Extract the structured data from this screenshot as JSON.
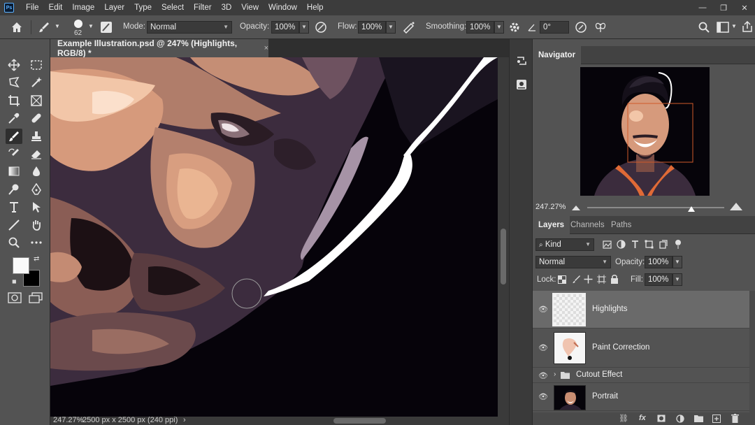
{
  "app": {
    "logo": "Ps"
  },
  "menu": [
    "File",
    "Edit",
    "Image",
    "Layer",
    "Type",
    "Select",
    "Filter",
    "3D",
    "View",
    "Window",
    "Help"
  ],
  "window_controls": [
    "—",
    "❐",
    "✕"
  ],
  "options": {
    "brush_size": "62",
    "mode_label": "Mode:",
    "mode_value": "Normal",
    "opacity_label": "Opacity:",
    "opacity_value": "100%",
    "flow_label": "Flow:",
    "flow_value": "100%",
    "smoothing_label": "Smoothing:",
    "smoothing_value": "100%",
    "angle_value": "0°"
  },
  "document": {
    "tab_title": "Example Illustration.psd @ 247% (Highlights, RGB/8) *",
    "close_glyph": "×",
    "status_zoom": "247.27%",
    "status_info": "2500 px x 2500 px (240 ppi)",
    "status_arrow": "›"
  },
  "navigator": {
    "title": "Navigator",
    "zoom": "247.27%",
    "zoom_slider_fraction": 0.76
  },
  "layers_panel": {
    "tabs": [
      "Layers",
      "Channels",
      "Paths"
    ],
    "filter_label": "Kind",
    "blend_mode": "Normal",
    "opacity_label": "Opacity:",
    "opacity_value": "100%",
    "lock_label": "Lock:",
    "fill_label": "Fill:",
    "fill_value": "100%",
    "layers": [
      {
        "name": "Highlights",
        "selected": true
      },
      {
        "name": "Paint Correction",
        "selected": false
      },
      {
        "name": "Cutout Effect",
        "selected": false,
        "group": true
      },
      {
        "name": "Portrait",
        "selected": false
      }
    ]
  },
  "colors": {
    "accent": "#5ab0ff",
    "ui_dark": "#2b2b2b",
    "panel": "#535353",
    "selection": "#6a6a6a",
    "skin_light": "#f2c6a8",
    "skin_mid": "#d69a7c",
    "skin_shadow": "#8a5d55",
    "purple": "#3b2c3d"
  }
}
